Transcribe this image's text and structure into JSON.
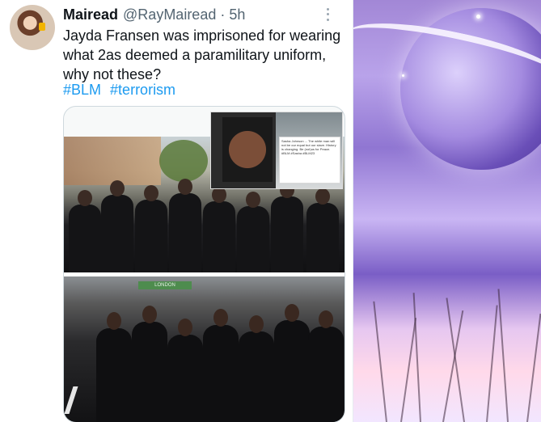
{
  "tweet": {
    "display_name": "Mairead",
    "handle_time": "@RayMairead · 5h",
    "text": "Jayda Fransen was imprisoned for wearing what 2as deemed a paramilitary uniform, why not these?",
    "hashtags": [
      "#BLM",
      "#terrorism"
    ]
  },
  "media": {
    "inset_tweet_text": "Sasha Johnson ... The white man will not be our equal but our slave. History is changing. Be (not)us for Peace. #BLM #Sasha #BLM23",
    "shop_sign": "LONDON"
  },
  "colors": {
    "accent": "#1d9bf0",
    "text": "#0f1419",
    "secondary": "#536471"
  }
}
